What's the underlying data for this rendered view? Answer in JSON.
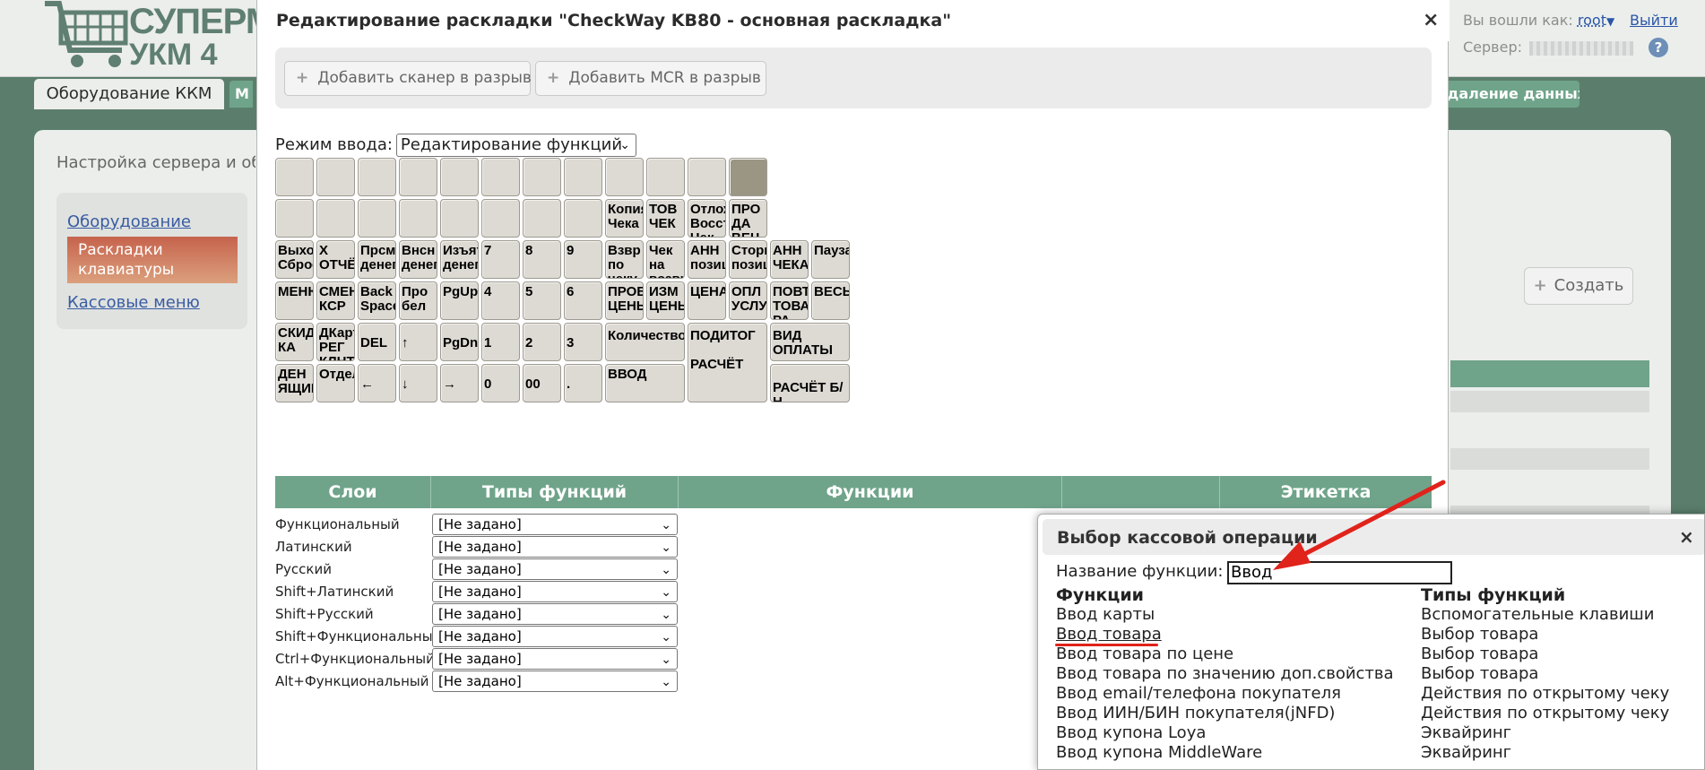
{
  "app": {
    "logo_text": "СУПЕРМАГ",
    "logo_sub": "УКМ 4",
    "logged_in_label": "Вы вошли как:",
    "username": "root",
    "logout_label": "Выйти",
    "server_label": "Сервер:",
    "help_icon": "?"
  },
  "nav": {
    "active_tab": "Оборудование ККМ",
    "partial_tab": "М",
    "right_tab": "удаление данных"
  },
  "page": {
    "breadcrumb": "Настройка сервера и обор",
    "sidebar": [
      "Оборудование",
      "Раскладки клавиатуры",
      "Кассовые меню"
    ],
    "create_label": "Создать",
    "create_icon": "plus-icon"
  },
  "editor": {
    "title": "Редактирование раскладки \"CheckWay KB80 - основная раскладка\"",
    "close": "×",
    "toolbar": {
      "add_scanner": "Добавить сканер в разрыв",
      "add_mcr": "Добавить MCR в разрыв"
    },
    "mode_label": "Режим ввода:",
    "mode_value": "Редактирование функций",
    "keys": {
      "r2c9": "Копия\nЧека",
      "r2c10": "ТОВ\nЧЕК",
      "r2c11": "Отлож\nВосст\nЧек",
      "r2c12": "ПРО\nДА\nВЕЦ",
      "r3c1": "Выход\nСброс",
      "r3c2": "Х\nОТЧЁТ",
      "r3c3": "Прсм\nденег",
      "r3c4": "Внсн\nденег",
      "r3c5": "Изъят\nденег",
      "r3c6": "7",
      "r3c7": "8",
      "r3c8": "9",
      "r3c9": "Взвр\nпо\nчеку",
      "r3c10": "Чек\nна\nвозвр",
      "r3c11": "АНН\nпозиц",
      "r3c12": "Сторн\nпозиц",
      "r3c13": "АНН\nЧЕКА",
      "r3c14": "Пауза",
      "r4c1": "МЕНЮ",
      "r4c2": "СМЕН\nКСР",
      "r4c3": "Back\nSpace",
      "r4c4": "Про\nбел",
      "r4c5": "PgUp",
      "r4c6": "4",
      "r4c7": "5",
      "r4c8": "6",
      "r4c9": "ПРОВ\nЦЕНЫ",
      "r4c10": "ИЗМ\nЦЕНЫ",
      "r4c11": "ЦЕНА",
      "r4c12": "ОПЛ\nУСЛУГ",
      "r4c13": "ПОВТ\nТОВА-\nРА",
      "r4c14": "ВЕСЫ",
      "r5c1": "СКИД\nКА",
      "r5c2": "ДКарт\nРЕГ\nКЛНТ",
      "r5c3": "DEL",
      "r5c4": "↑",
      "r5c5": "PgDn",
      "r5c6": "1",
      "r5c7": "2",
      "r5c8": "3",
      "r5c9": "Количество",
      "r5c11": "ПОДИТОГ\n\nРАСЧЁТ",
      "r5c13": "ВИД\nОПЛАТЫ",
      "r6c1": "ДЕН\nЯЩИК",
      "r6c2": "Отдел",
      "r6c3": "←",
      "r6c4": "↓",
      "r6c5": "→",
      "r6c6": "0",
      "r6c7": "00",
      "r6c8": ".",
      "r6c9": "ВВОД",
      "r6c13": "РАСЧЁТ Б/Н"
    },
    "layers": {
      "headers": [
        "Слои",
        "Типы функций",
        "Функции",
        "",
        "Этикетка"
      ],
      "rows": [
        {
          "name": "Функциональный",
          "value": "[Не задано]"
        },
        {
          "name": "Латинский",
          "value": "[Не задано]"
        },
        {
          "name": "Русский",
          "value": "[Не задано]"
        },
        {
          "name": "Shift+Латинский",
          "value": "[Не задано]"
        },
        {
          "name": "Shift+Русский",
          "value": "[Не задано]"
        },
        {
          "name": "Shift+Функциональный",
          "value": "[Не задано]"
        },
        {
          "name": "Ctrl+Функциональный",
          "value": "[Не задано]"
        },
        {
          "name": "Alt+Функциональный",
          "value": "[Не задано]"
        }
      ]
    }
  },
  "chooser": {
    "title": "Выбор кассовой операции",
    "close": "×",
    "search_label": "Название функции:",
    "search_value": "Ввод",
    "col_functions": "Функции",
    "col_types": "Типы функций",
    "rows": [
      {
        "fn": "Ввод карты",
        "type": "Вспомогательные клавиши"
      },
      {
        "fn": "Ввод товара",
        "type": "Выбор товара"
      },
      {
        "fn": "Ввод товара по цене",
        "type": "Выбор товара"
      },
      {
        "fn": "Ввод товара по значению доп.свойства",
        "type": "Выбор товара"
      },
      {
        "fn": "Ввод email/телефона покупателя",
        "type": "Действия по открытому чеку"
      },
      {
        "fn": "Ввод ИИН/БИН покупателя(jNFD)",
        "type": "Действия по открытому чеку"
      },
      {
        "fn": "Ввод купона Loya",
        "type": "Эквайринг"
      },
      {
        "fn": "Ввод купона MiddleWare",
        "type": "Эквайринг"
      }
    ],
    "annotation_color": "#e0231b"
  }
}
